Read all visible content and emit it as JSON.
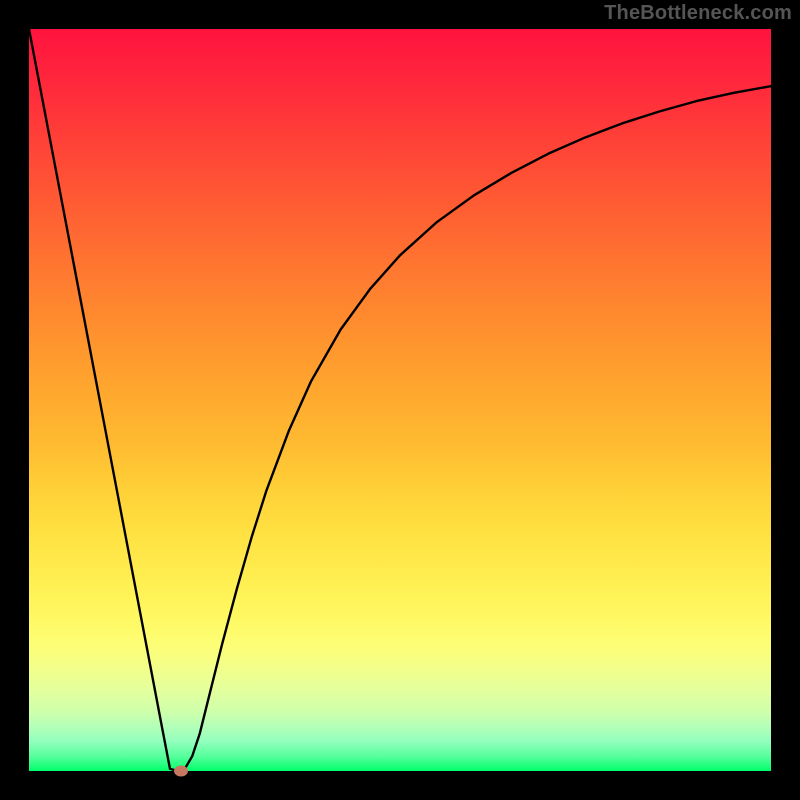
{
  "watermark": "TheBottleneck.com",
  "chart_data": {
    "type": "line",
    "title": "",
    "xlabel": "",
    "ylabel": "",
    "xlim": [
      0,
      100
    ],
    "ylim": [
      0,
      100
    ],
    "grid": false,
    "series": [
      {
        "name": "curve",
        "color": "#000000",
        "x": [
          0,
          2,
          4,
          6,
          8,
          10,
          12,
          14,
          16,
          18,
          19,
          20,
          21,
          22,
          23,
          24,
          26,
          28,
          30,
          32,
          35,
          38,
          42,
          46,
          50,
          55,
          60,
          65,
          70,
          75,
          80,
          85,
          90,
          95,
          100
        ],
        "y": [
          100,
          89.5,
          79.0,
          68.5,
          58.0,
          47.5,
          37.0,
          26.5,
          16.0,
          5.5,
          0.3,
          0.0,
          0.3,
          2.0,
          5.0,
          9.0,
          17.0,
          24.5,
          31.5,
          37.8,
          45.8,
          52.5,
          59.5,
          65.0,
          69.5,
          74.0,
          77.6,
          80.6,
          83.2,
          85.4,
          87.3,
          88.9,
          90.3,
          91.4,
          92.3
        ]
      }
    ],
    "marker": {
      "x": 20.5,
      "y": 0.0,
      "color": "#c77860"
    },
    "background_gradient": {
      "top": "#ff133e",
      "bottom": "#00ff6b"
    }
  }
}
